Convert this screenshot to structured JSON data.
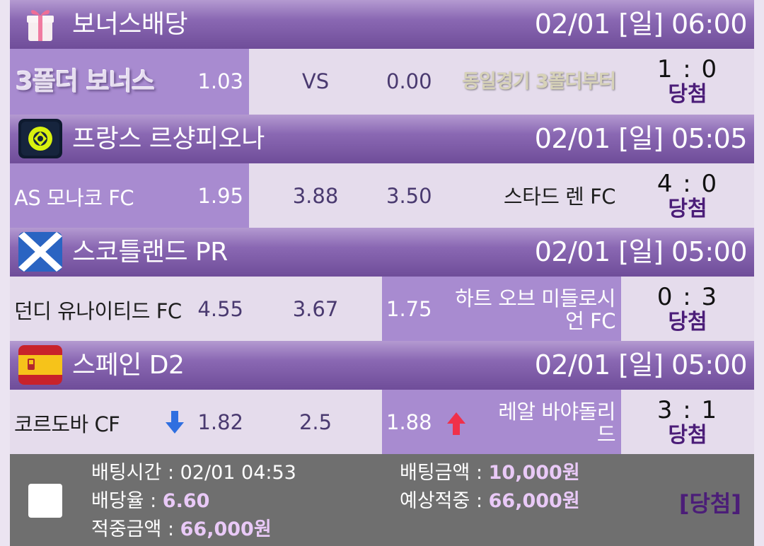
{
  "leagues": [
    {
      "name": "보너스배당",
      "time": "02/01 [일] 06:00",
      "logo_icon": "gift-box-icon",
      "match": {
        "home": "3폴더 보너스",
        "home_odd": "1.03",
        "draw": "VS",
        "away_odd": "0.00",
        "away": "동일경기 3폴더부터",
        "score": "1 : 0",
        "result": "당첨"
      }
    },
    {
      "name": "프랑스 르샹피오나",
      "time": "02/01 [일] 05:05",
      "logo_icon": "ligue1-logo-icon",
      "match": {
        "home": "AS 모나코 FC",
        "home_odd": "1.95",
        "draw": "3.88",
        "away_odd": "3.50",
        "away": "스타드 렌 FC",
        "score": "4 : 0",
        "result": "당첨"
      }
    },
    {
      "name": "스코틀랜드 PR",
      "time": "02/01 [일] 05:00",
      "logo_icon": "scotland-flag-icon",
      "match": {
        "home": "던디 유나이티드 FC",
        "home_odd": "4.55",
        "draw": "3.67",
        "away_odd": "1.75",
        "away": "하트 오브 미들로시언 FC",
        "score": "0 : 3",
        "result": "당첨"
      }
    },
    {
      "name": "스페인 D2",
      "time": "02/01 [일] 05:00",
      "logo_icon": "spain-flag-icon",
      "match": {
        "home": "코르도바 CF",
        "home_odd": "1.82",
        "draw": "2.5",
        "away_odd": "1.88",
        "away": "레알 바야돌리드",
        "score": "3 : 1",
        "result": "당첨"
      }
    }
  ],
  "footer": {
    "bet_time_label": "배팅시간 : ",
    "bet_time": "02/01 04:53",
    "odds_label": "배당율 : ",
    "odds": "6.60",
    "win_amount_label": "적중금액 : ",
    "win_amount": "66,000원",
    "bet_amount_label": "배팅금액 : ",
    "bet_amount": "10,000원",
    "expected_label": "예상적중 : ",
    "expected": "66,000원",
    "result": "[당첨]"
  },
  "colors": {
    "header_purple": "#7a58a6",
    "selected_cell": "#a88bd0",
    "row_bg": "#e5dcec",
    "footer_bg": "#6f6f6f",
    "result_text": "#4b1d78",
    "arrow_down": "#2f6fe0",
    "arrow_up": "#f0304a"
  }
}
